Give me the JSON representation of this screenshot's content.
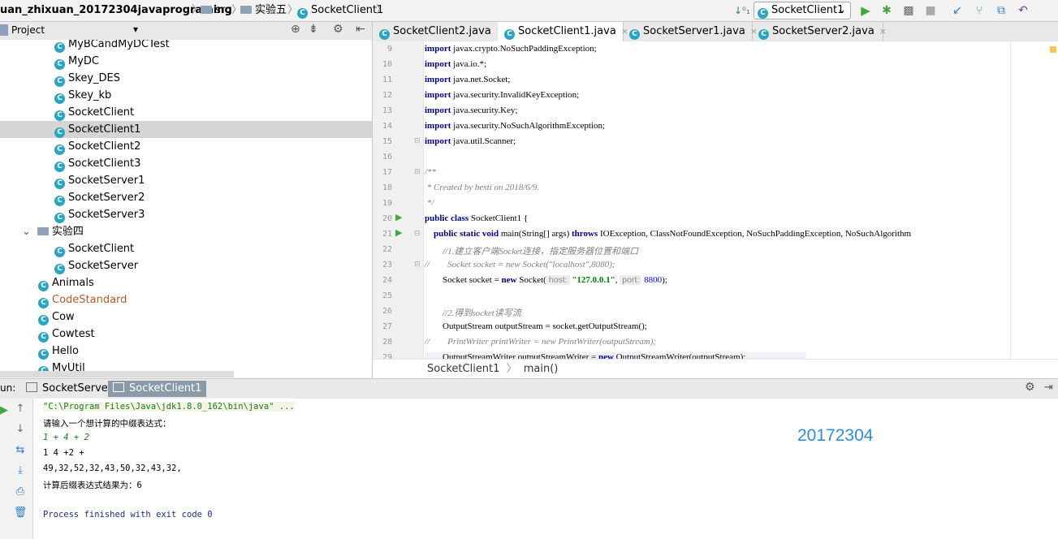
{
  "nav": {
    "project": "uan_zhixuan_20172304javaprograming",
    "src": "src",
    "package": "实验五",
    "file": "SocketClient1",
    "sep": "〉"
  },
  "toolbar": {
    "run_config": "SocketClient1",
    "run_config_arrow": "⌄"
  },
  "project_panel": {
    "title": "Project",
    "title_arrow": "▾",
    "items": [
      {
        "label": "MyBCandMyDCTest"
      },
      {
        "label": "MyDC"
      },
      {
        "label": "Skey_DES"
      },
      {
        "label": "Skey_kb"
      },
      {
        "label": "SocketClient"
      },
      {
        "label": "SocketClient1"
      },
      {
        "label": "SocketClient2"
      },
      {
        "label": "SocketClient3"
      },
      {
        "label": "SocketServer1"
      },
      {
        "label": "SocketServer2"
      },
      {
        "label": "SocketServer3"
      },
      {
        "label": "实验四"
      },
      {
        "label": "SocketClient"
      },
      {
        "label": "SocketServer"
      },
      {
        "label": "Animals"
      },
      {
        "label": "CodeStandard"
      },
      {
        "label": "Cow"
      },
      {
        "label": "Cowtest"
      },
      {
        "label": "Hello"
      },
      {
        "label": "MyUtil"
      }
    ]
  },
  "editor": {
    "tabs": [
      {
        "label": "SocketClient2.java"
      },
      {
        "label": "SocketClient1.java"
      },
      {
        "label": "SocketServer1.java"
      },
      {
        "label": "SocketServer2.java"
      }
    ],
    "tab_close": "×",
    "line_numbers": [
      "9",
      "10",
      "11",
      "12",
      "13",
      "14",
      "15",
      "16",
      "17",
      "18",
      "19",
      "20",
      "21",
      "22",
      "23",
      "24",
      "25",
      "26",
      "27",
      "28",
      "29"
    ],
    "lines": {
      "l9": "javax.crypto.NoSuchPaddingException;",
      "l10": "java.io.*;",
      "l11": "java.net.Socket;",
      "l12": "java.security.InvalidKeyException;",
      "l13": "java.security.Key;",
      "l14": "java.security.NoSuchAlgorithmException;",
      "l15": "java.util.Scanner;",
      "l17": "/**",
      "l18": " * Created by besti on 2018/6/9.",
      "l19": " */",
      "l20_rest": " SocketClient1 {",
      "l21_a": "main(String[] args) ",
      "l21_b": " IOException, ClassNotFoundException, NoSuchPaddingException, NoSuchAlgorithm",
      "l22": "        //1.建立客户端Socket连接，指定服务器位置和端口",
      "l23": "//        Socket socket = new Socket(\"localhost\",8080);",
      "l24_a": "        Socket socket = ",
      "l24_b": " Socket(",
      "l24_str": "\"127.0.0.1\"",
      "l24_num": "8800",
      "l24_end": ");",
      "l26": "        //2.得到socket读写流",
      "l27": "        OutputStream outputStream = socket.getOutputStream();",
      "l28": "//        PrintWriter printWriter = new PrintWriter(outputStream);",
      "l29_a": "        OutputStreamWriter outputStreamWriter = ",
      "l29_b": " OutputStreamWriter(outputStream);"
    },
    "kw": {
      "import": "import",
      "public": "public",
      "class": "class",
      "static": "static",
      "void": "void",
      "throws": "throws",
      "new": "new"
    },
    "hints": {
      "host": "host:",
      "port": "port:"
    },
    "breadcrumb": {
      "class": "SocketClient1",
      "method": "main()",
      "sep": "〉"
    }
  },
  "run_panel": {
    "label": "un:",
    "tabs": [
      {
        "label": "SocketServer1"
      },
      {
        "label": "SocketClient1"
      }
    ],
    "console": [
      "\"C:\\Program Files\\Java\\jdk1.8.0_162\\bin\\java\" ...",
      "请输入一个想计算的中缀表达式：",
      "1 + 4 + 2",
      "1 4 +2 +",
      "49,32,52,32,43,50,32,43,32,",
      "计算后缀表达式结果为：6",
      "Process finished with exit code 0"
    ],
    "watermark": "20172304"
  },
  "colors": {
    "accent_green": "#499c54",
    "watermark_blue": "#2a8fe0",
    "selection": "#d5d5d5"
  }
}
